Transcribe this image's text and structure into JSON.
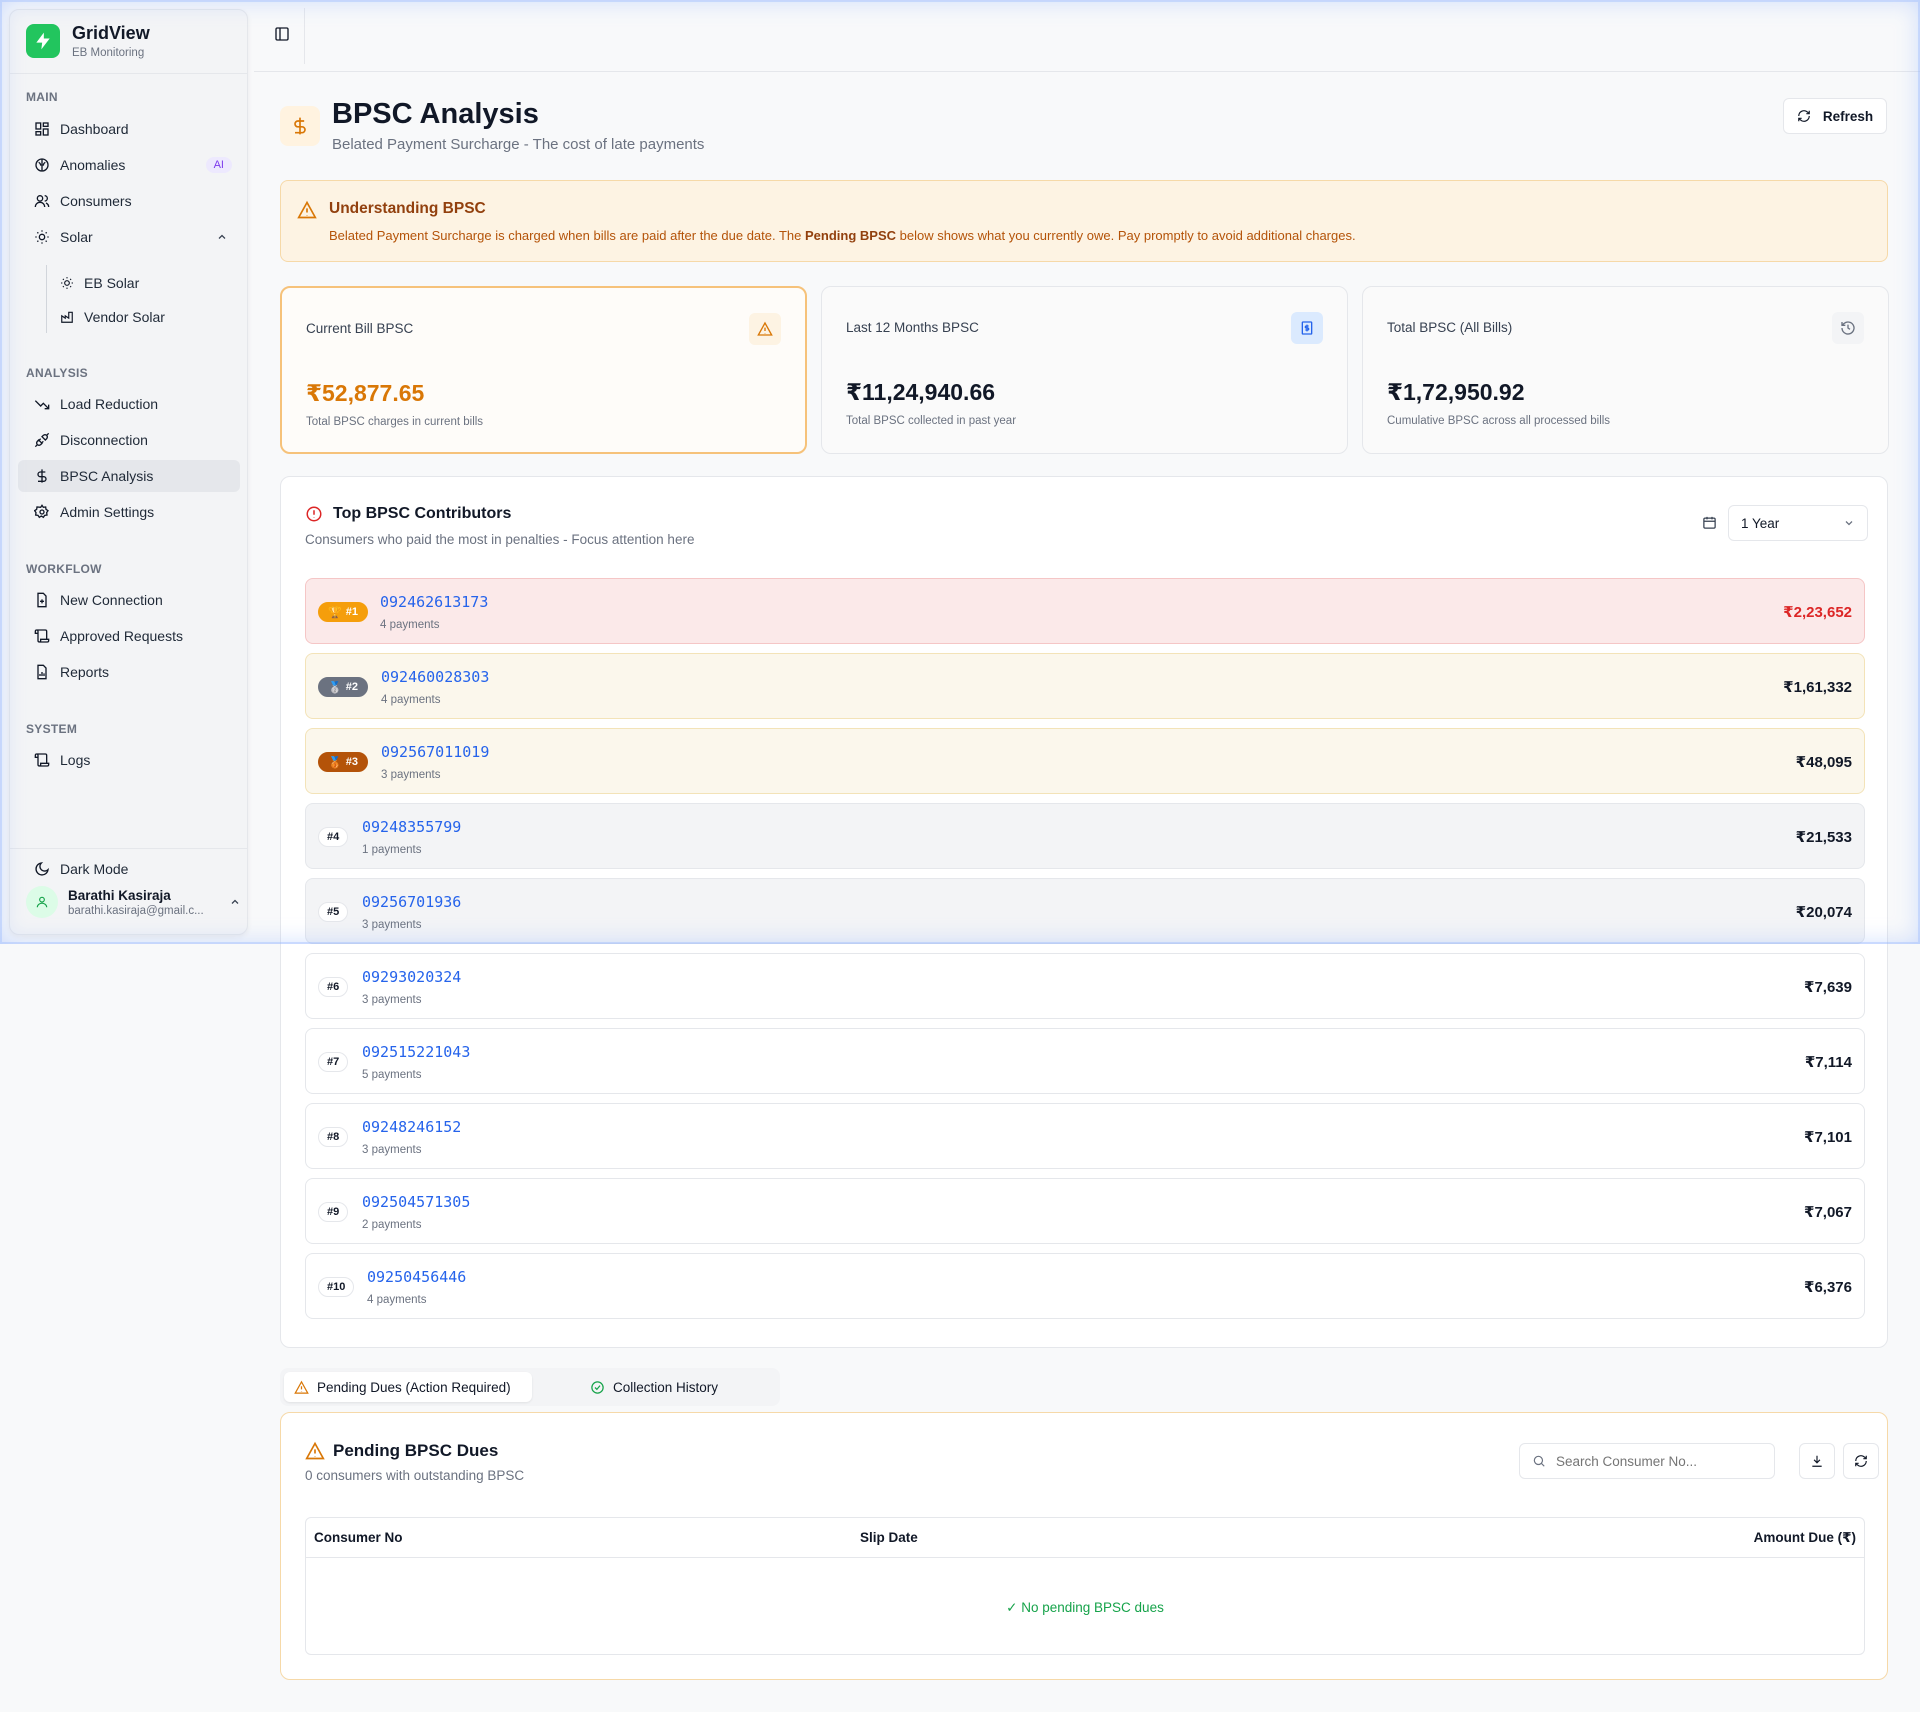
{
  "brand": {
    "name": "GridView",
    "subtitle": "EB Monitoring"
  },
  "sidebar": {
    "sections": {
      "main": "MAIN",
      "analysis": "ANALYSIS",
      "workflow": "WORKFLOW",
      "system": "SYSTEM"
    },
    "items": {
      "dashboard": "Dashboard",
      "anomalies": "Anomalies",
      "anomalies_badge": "AI",
      "consumers": "Consumers",
      "solar": "Solar",
      "eb_solar": "EB Solar",
      "vendor_solar": "Vendor Solar",
      "load_reduction": "Load Reduction",
      "disconnection": "Disconnection",
      "bpsc_analysis": "BPSC Analysis",
      "admin_settings": "Admin Settings",
      "new_connection": "New Connection",
      "approved_requests": "Approved Requests",
      "reports": "Reports",
      "logs": "Logs"
    },
    "dark_mode": "Dark Mode",
    "user": {
      "name": "Barathi Kasiraja",
      "email": "barathi.kasiraja@gmail.c..."
    }
  },
  "page": {
    "title": "BPSC Analysis",
    "subtitle": "Belated Payment Surcharge - The cost of late payments",
    "refresh_label": "Refresh"
  },
  "banner": {
    "title": "Understanding BPSC",
    "text_before": "Belated Payment Surcharge is charged when bills are paid after the due date. The ",
    "text_bold": "Pending BPSC",
    "text_after": " below shows what you currently owe. Pay promptly to avoid additional charges."
  },
  "cards": [
    {
      "label": "Current Bill BPSC",
      "value": "₹52,877.65",
      "desc": "Total BPSC charges in current bills",
      "icon": "warning-icon"
    },
    {
      "label": "Last 12 Months BPSC",
      "value": "₹11,24,940.66",
      "desc": "Total BPSC collected in past year",
      "icon": "receipt-icon"
    },
    {
      "label": "Total BPSC (All Bills)",
      "value": "₹1,72,950.92",
      "desc": "Cumulative BPSC across all processed bills",
      "icon": "history-icon"
    }
  ],
  "contributors": {
    "title": "Top BPSC Contributors",
    "subtitle": "Consumers who paid the most in penalties - Focus attention here",
    "period": "1 Year",
    "rows": [
      {
        "rank": "#1",
        "consumer": "092462613173",
        "payments": "4 payments",
        "amount": "₹2,23,652"
      },
      {
        "rank": "#2",
        "consumer": "092460028303",
        "payments": "4 payments",
        "amount": "₹1,61,332"
      },
      {
        "rank": "#3",
        "consumer": "092567011019",
        "payments": "3 payments",
        "amount": "₹48,095"
      },
      {
        "rank": "#4",
        "consumer": "09248355799",
        "payments": "1 payments",
        "amount": "₹21,533"
      },
      {
        "rank": "#5",
        "consumer": "09256701936",
        "payments": "3 payments",
        "amount": "₹20,074"
      },
      {
        "rank": "#6",
        "consumer": "09293020324",
        "payments": "3 payments",
        "amount": "₹7,639"
      },
      {
        "rank": "#7",
        "consumer": "092515221043",
        "payments": "5 payments",
        "amount": "₹7,114"
      },
      {
        "rank": "#8",
        "consumer": "09248246152",
        "payments": "3 payments",
        "amount": "₹7,101"
      },
      {
        "rank": "#9",
        "consumer": "092504571305",
        "payments": "2 payments",
        "amount": "₹7,067"
      },
      {
        "rank": "#10",
        "consumer": "09250456446",
        "payments": "4 payments",
        "amount": "₹6,376"
      }
    ]
  },
  "tabs": {
    "pending": "Pending Dues (Action Required)",
    "history": "Collection History"
  },
  "pending": {
    "title": "Pending BPSC Dues",
    "subtitle": "0 consumers with outstanding BPSC",
    "search_placeholder": "Search Consumer No...",
    "columns": {
      "consumer": "Consumer No",
      "slip_date": "Slip Date",
      "amount": "Amount Due (₹)"
    },
    "empty": "✓ No pending BPSC dues"
  },
  "colors": {
    "accent": "#22c55e",
    "warning": "#d97706",
    "link": "#2563eb",
    "danger": "#dc2626"
  }
}
